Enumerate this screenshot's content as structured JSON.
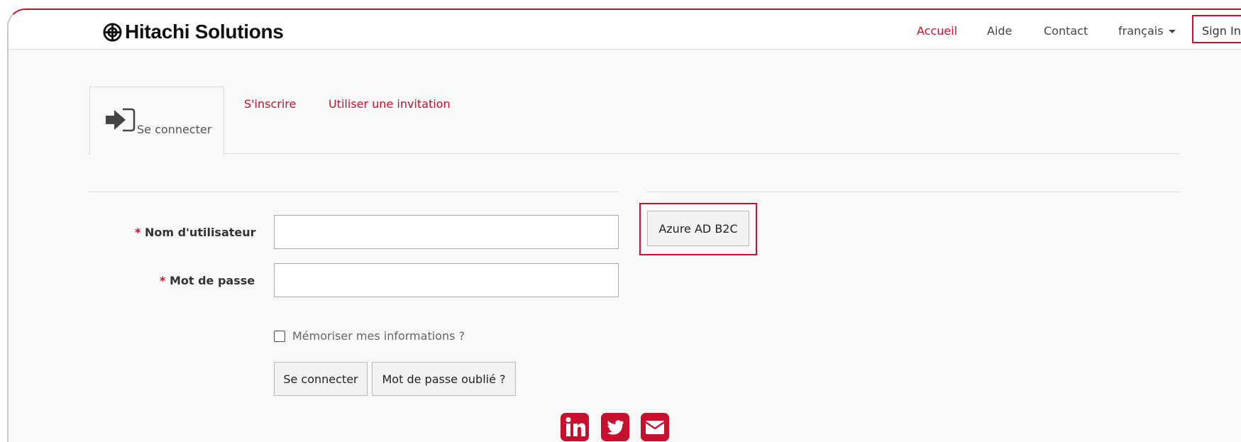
{
  "header": {
    "brand": "Hitachi Solutions",
    "nav": {
      "home": "Accueil",
      "help": "Aide",
      "contact": "Contact",
      "language": "français",
      "sign_in": "Sign In"
    }
  },
  "tabs": {
    "sign_in": "Se connecter",
    "register": "S'inscrire",
    "redeem_invitation": "Utiliser une invitation"
  },
  "form": {
    "required_marker": "*",
    "username_label": "Nom d'utilisateur",
    "username_value": "",
    "password_label": "Mot de passe",
    "password_value": "",
    "remember_label": "Mémoriser mes informations ?",
    "remember_checked": false,
    "submit_label": "Se connecter",
    "forgot_label": "Mot de passe oublié ?"
  },
  "external_login": {
    "provider_button": "Azure AD B2C"
  },
  "footer": {
    "social_icons": [
      "linkedin-icon",
      "twitter-icon",
      "email-icon"
    ]
  },
  "colors": {
    "brand_red": "#c8102e",
    "page_bg": "#f8f8f8",
    "text": "#333333"
  }
}
